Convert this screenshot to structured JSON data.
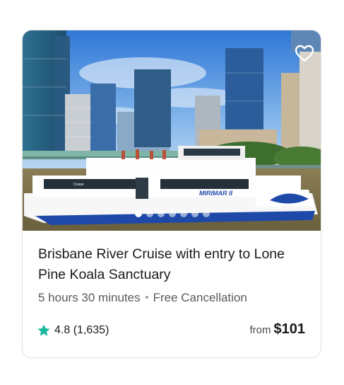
{
  "card": {
    "title": "Brisbane River Cruise with entry to Lone Pine Koala Sanctuary",
    "duration": "5 hours 30 minutes",
    "cancellation": "Free Cancellation",
    "rating": "4.8",
    "review_count": "(1,635)",
    "price_prefix": "from",
    "price": "$101",
    "image": {
      "boat_name": "MIRIMAR II",
      "dots_total": 7,
      "active_dot": 1
    },
    "icons": {
      "wishlist": "heart-outline-icon",
      "rating": "star-icon"
    },
    "colors": {
      "star": "#1db89d",
      "text": "#1a1a1a",
      "muted": "#5a5a5a"
    }
  }
}
